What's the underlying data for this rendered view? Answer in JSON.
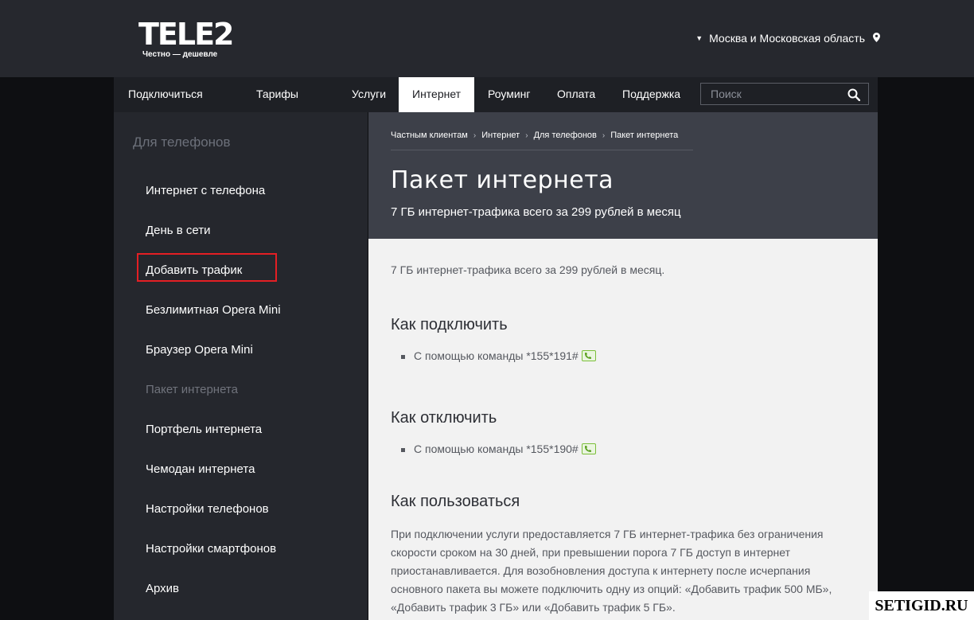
{
  "header": {
    "logo_text": "TELE2",
    "logo_slogan": "Честно — дешевле",
    "region": "Москва и Московская область"
  },
  "nav": {
    "items": [
      "Подключиться",
      "Тарифы",
      "Услуги",
      "Интернет",
      "Роуминг",
      "Оплата",
      "Поддержка"
    ],
    "active": "Интернет",
    "search_placeholder": "Поиск"
  },
  "sidebar": {
    "title": "Для телефонов",
    "items": [
      "Интернет с телефона",
      "День в сети",
      "Добавить трафик",
      "Безлимитная Opera Mini",
      "Браузер Opera Mini",
      "Пакет интернета",
      "Портфель интернета",
      "Чемодан интернета",
      "Настройки телефонов",
      "Настройки смартфонов",
      "Архив"
    ],
    "current": "Пакет интернета",
    "highlighted": "Добавить трафик"
  },
  "breadcrumb": [
    "Частным клиентам",
    "Интернет",
    "Для телефонов",
    "Пакет интернета"
  ],
  "page": {
    "title": "Пакет интернета",
    "subtitle": "7 ГБ интернет-трафика всего за 299 рублей в месяц",
    "intro": "7 ГБ интернет-трафика всего за 299 рублей в месяц.",
    "connect_heading": "Как подключить",
    "connect_text": "С помощью команды *155*191#",
    "disconnect_heading": "Как отключить",
    "disconnect_text": "С помощью команды *155*190#",
    "usage_heading": "Как пользоваться",
    "usage_lines": [
      "При подключении услуги предоставляется 7 ГБ интернет-трафика без ограничения",
      "скорости сроком на 30 дней, при превышении порога 7 ГБ доступ в интернет",
      "приостанавливается. Для возобновления доступа к интернету после исчерпания",
      "основного пакета вы можете подключить одну из опций: «Добавить трафик 500 МБ»,",
      "«Добавить трафик 3 ГБ» или «Добавить трафик 5 ГБ»."
    ]
  },
  "watermark": "SETIGID.RU",
  "colors": {
    "highlight": "#e41f24",
    "call_button": "#7bbf3a"
  }
}
